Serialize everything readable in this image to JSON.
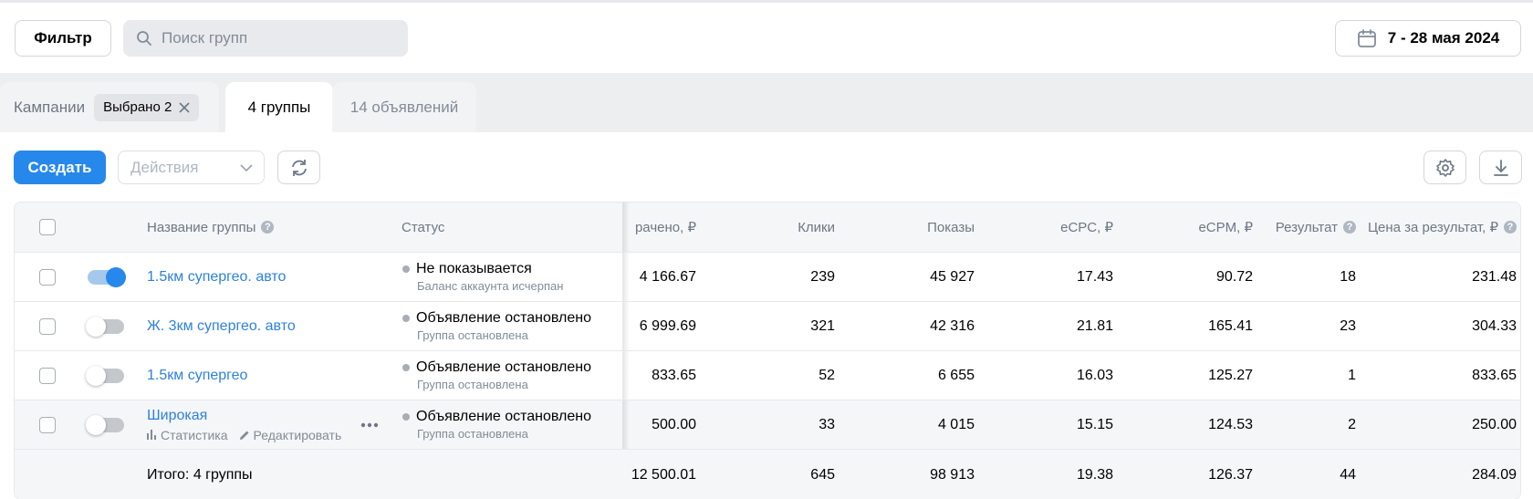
{
  "topbar": {
    "filter_label": "Фильтр",
    "search_placeholder": "Поиск групп",
    "date_range": "7 - 28 мая 2024"
  },
  "tabs": {
    "campaigns_label": "Кампании",
    "campaigns_chip": "Выбрано 2",
    "groups_label": "4 группы",
    "ads_label": "14 объявлений"
  },
  "toolbar": {
    "create_label": "Создать",
    "actions_placeholder": "Действия"
  },
  "table": {
    "headers": {
      "name": "Название группы",
      "status": "Статус",
      "spent": "рачено, ₽",
      "clicks": "Клики",
      "impressions": "Показы",
      "ecpc": "eCPC, ₽",
      "ecpm": "eCPM, ₽",
      "result": "Результат",
      "price": "Цена за результат, ₽"
    },
    "rows": [
      {
        "name": "1.5км супергео. авто",
        "enabled": true,
        "status": "Не показывается",
        "status_sub": "Баланс аккаунта исчерпан",
        "spent": "4 166.67",
        "clicks": "239",
        "impressions": "45 927",
        "ecpc": "17.43",
        "ecpm": "90.72",
        "result": "18",
        "price": "231.48"
      },
      {
        "name": "Ж. 3км супергео. авто",
        "enabled": false,
        "status": "Объявление остановлено",
        "status_sub": "Группа остановлена",
        "spent": "6 999.69",
        "clicks": "321",
        "impressions": "42 316",
        "ecpc": "21.81",
        "ecpm": "165.41",
        "result": "23",
        "price": "304.33"
      },
      {
        "name": "1.5км супергео",
        "enabled": false,
        "status": "Объявление остановлено",
        "status_sub": "Группа остановлена",
        "spent": "833.65",
        "clicks": "52",
        "impressions": "6 655",
        "ecpc": "16.03",
        "ecpm": "125.27",
        "result": "1",
        "price": "833.65"
      },
      {
        "name": "Широкая",
        "enabled": false,
        "status": "Объявление остановлено",
        "status_sub": "Группа остановлена",
        "spent": "500.00",
        "clicks": "33",
        "impressions": "4 015",
        "ecpc": "15.15",
        "ecpm": "124.53",
        "result": "2",
        "price": "250.00",
        "stats_link": "Статистика",
        "edit_link": "Редактировать"
      }
    ],
    "total": {
      "label": "Итого: 4 группы",
      "spent": "12 500.01",
      "clicks": "645",
      "impressions": "98 913",
      "ecpc": "19.38",
      "ecpm": "126.37",
      "result": "44",
      "price": "284.09"
    }
  },
  "icons": {
    "search": "search-icon",
    "calendar": "calendar-icon",
    "refresh": "refresh-icon",
    "settings": "gear-icon",
    "download": "download-icon",
    "close": "close-icon",
    "chevron": "chevron-down-icon",
    "help": "help-icon",
    "more": "more-icon"
  },
  "colors": {
    "accent": "#2688eb",
    "link": "#2d81e0"
  }
}
